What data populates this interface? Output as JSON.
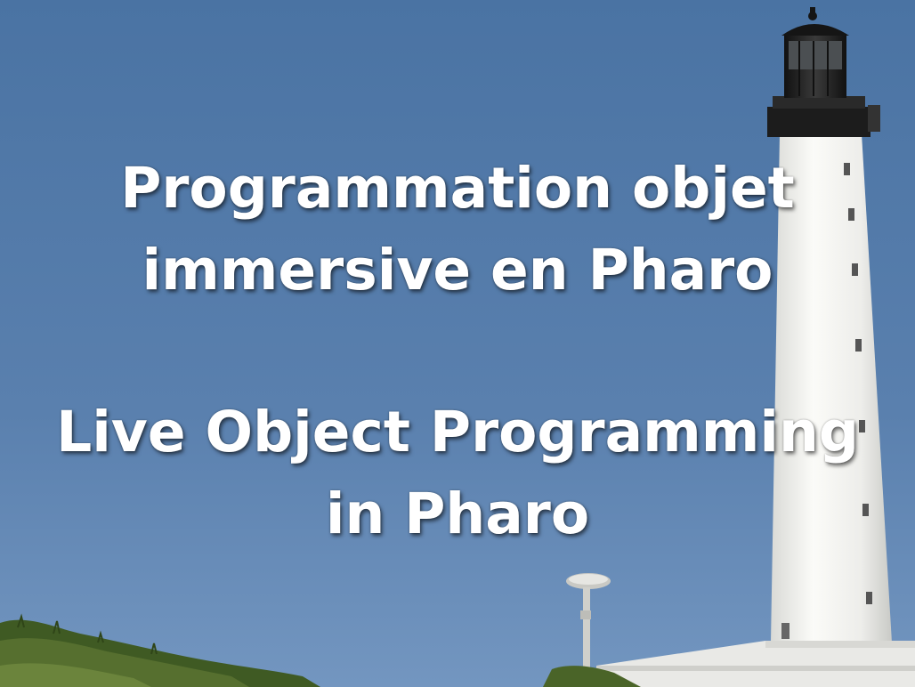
{
  "slide": {
    "title_fr": {
      "line1": "Programmation objet",
      "line2": "immersive en Pharo"
    },
    "title_en": {
      "line1": "Live Object Programming",
      "line2": "in Pharo"
    }
  },
  "colors": {
    "sky_top": "#4f78a6",
    "sky_bottom": "#6e93bf",
    "lighthouse_white": "#f2f2ef",
    "lantern_dark": "#1e1e1e",
    "vegetation": "#4f6b2a",
    "text": "#ffffff"
  }
}
